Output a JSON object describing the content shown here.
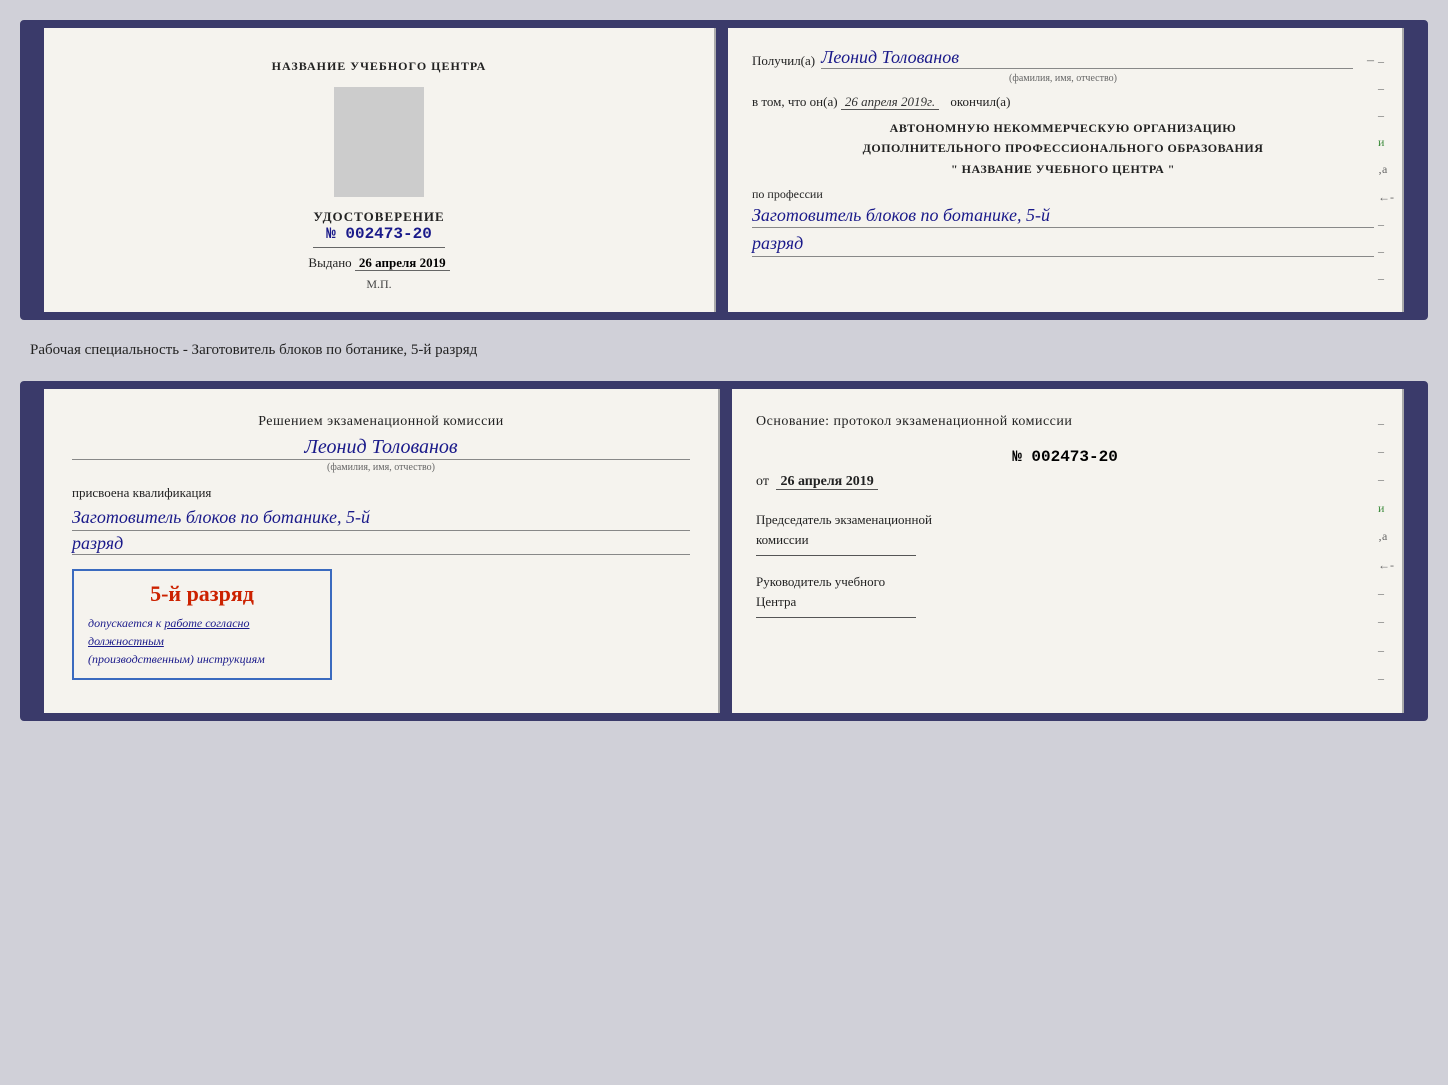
{
  "top_doc": {
    "left": {
      "training_center": "НАЗВАНИЕ УЧЕБНОГО ЦЕНТРА",
      "cert_label": "УДОСТОВЕРЕНИЕ",
      "cert_number": "№ 002473-20",
      "vydano_label": "Выдано",
      "vydano_date": "26 апреля 2019",
      "mp_label": "М.П."
    },
    "right": {
      "poluchil_label": "Получил(а)",
      "recipient_name": "Леонид Толованов",
      "fio_sub": "(фамилия, имя, отчество)",
      "vtom_prefix": "в том, что он(а)",
      "vtom_date": "26 апреля 2019г.",
      "vtom_suffix": "окончил(а)",
      "org_line1": "АВТОНОМНУЮ НЕКОММЕРЧЕСКУЮ ОРГАНИЗАЦИЮ",
      "org_line2": "ДОПОЛНИТЕЛЬНОГО ПРОФЕССИОНАЛЬНОГО ОБРАЗОВАНИЯ",
      "org_line3": "\"  НАЗВАНИЕ УЧЕБНОГО ЦЕНТРА  \"",
      "po_professii": "по профессии",
      "profession": "Заготовитель блоков по ботанике, 5-й",
      "razryad": "разряд"
    }
  },
  "specialty_label": "Рабочая специальность - Заготовитель блоков по ботанике, 5-й разряд",
  "bottom_doc": {
    "left": {
      "resheniem_line1": "Решением экзаменационной комиссии",
      "bottom_name": "Леонид Толованов",
      "fio_sub": "(фамилия, имя, отчество)",
      "prisvoena": "присвоена квалификация",
      "profession": "Заготовитель блоков по ботанике, 5-й",
      "razryad": "разряд",
      "stamp_main": "5-й разряд",
      "stamp_sub_prefix": "допускается к",
      "stamp_sub_underline": "работе согласно должностным",
      "stamp_sub_italic": "(производственным) инструкциям"
    },
    "right": {
      "osnovanie": "Основание: протокол экзаменационной комиссии",
      "protocol_num": "№  002473-20",
      "ot_label": "от",
      "ot_date": "26 апреля 2019",
      "chairman_line1": "Председатель экзаменационной",
      "chairman_line2": "комиссии",
      "ruk_line1": "Руководитель учебного",
      "ruk_line2": "Центра"
    }
  }
}
